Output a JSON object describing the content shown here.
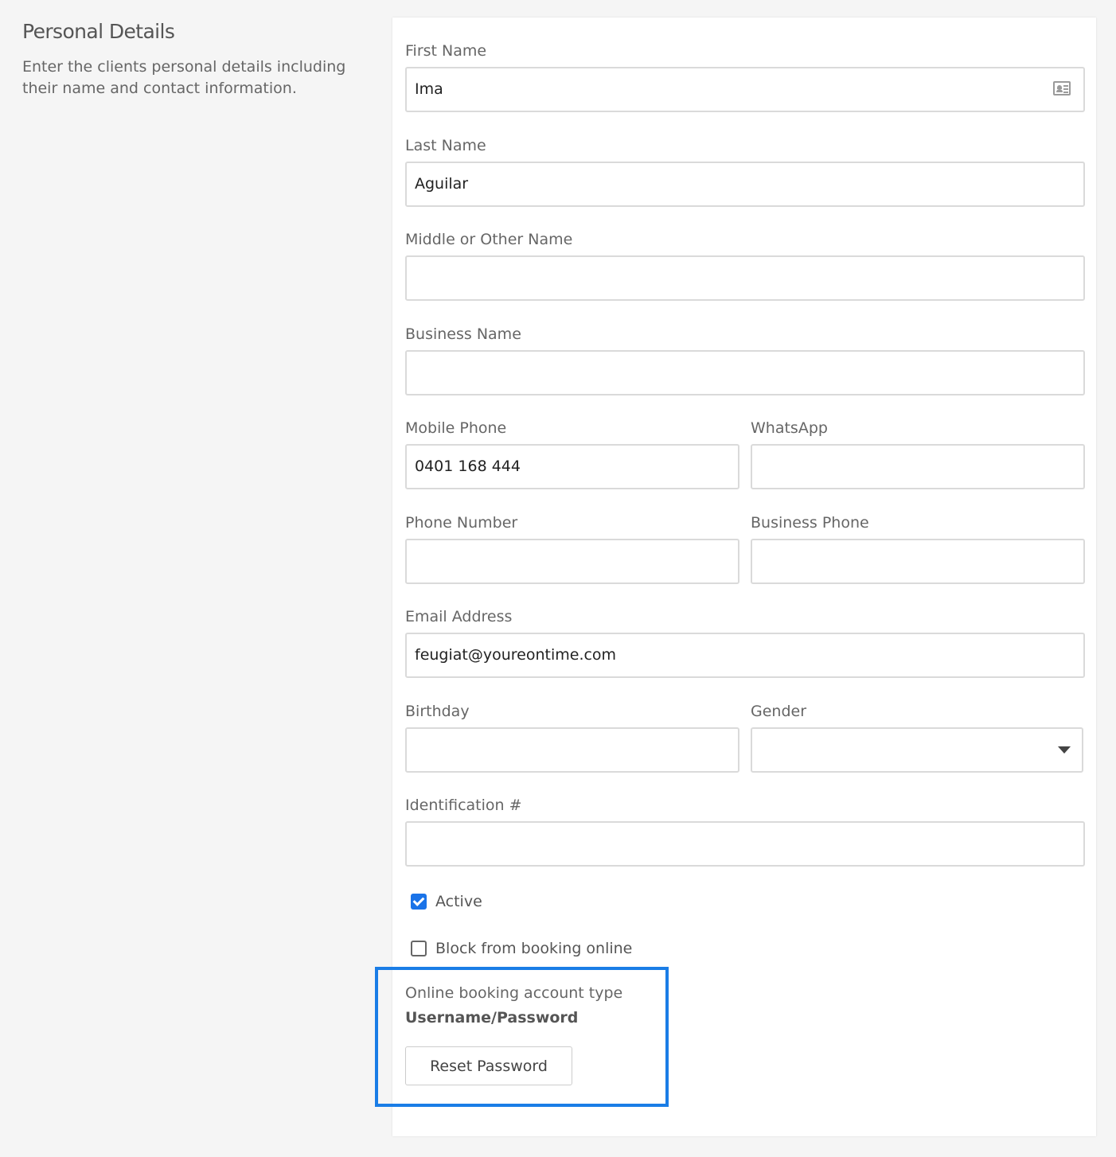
{
  "section": {
    "title": "Personal Details",
    "description": "Enter the clients personal details including their name and contact information."
  },
  "fields": {
    "first_name": {
      "label": "First Name",
      "value": "Ima",
      "icon": "contact-card-icon"
    },
    "last_name": {
      "label": "Last Name",
      "value": "Aguilar"
    },
    "middle_name": {
      "label": "Middle or Other Name",
      "value": ""
    },
    "business_name": {
      "label": "Business Name",
      "value": ""
    },
    "mobile_phone": {
      "label": "Mobile Phone",
      "value": "0401 168 444"
    },
    "whatsapp": {
      "label": "WhatsApp",
      "value": ""
    },
    "phone_number": {
      "label": "Phone Number",
      "value": ""
    },
    "business_phone": {
      "label": "Business Phone",
      "value": ""
    },
    "email": {
      "label": "Email Address",
      "value": "feugiat@youreontime.com"
    },
    "birthday": {
      "label": "Birthday",
      "value": ""
    },
    "gender": {
      "label": "Gender",
      "value": "",
      "icon": "chevron-down-icon"
    },
    "identification": {
      "label": "Identification #",
      "value": ""
    }
  },
  "checkboxes": {
    "active": {
      "label": "Active",
      "checked": true
    },
    "block_online": {
      "label": "Block from booking online",
      "checked": false
    }
  },
  "online_booking": {
    "label": "Online booking account type",
    "value": "Username/Password",
    "reset_button": "Reset Password"
  },
  "colors": {
    "accent": "#1a73e8",
    "highlight_border": "#1a7de6",
    "page_background": "#f5f5f5",
    "card_background": "#ffffff"
  }
}
